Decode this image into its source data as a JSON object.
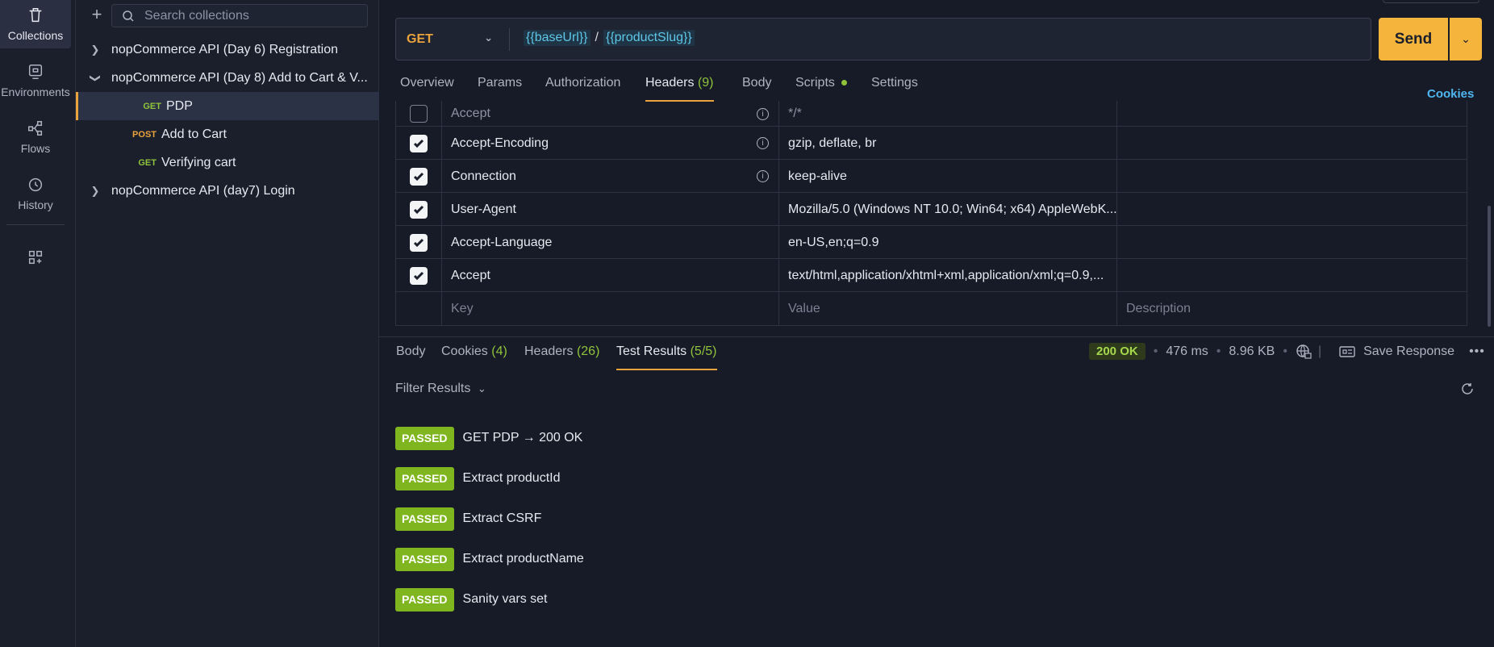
{
  "rail": {
    "items": [
      {
        "label": "Collections",
        "icon": "trash-can-icon"
      },
      {
        "label": "Environments",
        "icon": "environment-icon"
      },
      {
        "label": "Flows",
        "icon": "flows-icon"
      },
      {
        "label": "History",
        "icon": "history-icon"
      }
    ]
  },
  "sidebar": {
    "search_placeholder": "Search collections",
    "tree": [
      {
        "label": "nopCommerce API (Day 6) Registration",
        "chevron": "›"
      },
      {
        "label": "nopCommerce API (Day 8) Add to Cart & V...",
        "chevron": "⌄"
      },
      {
        "method": "GET",
        "label": "PDP"
      },
      {
        "method": "POST",
        "label": "Add to Cart"
      },
      {
        "method": "GET",
        "label": "Verifying cart"
      },
      {
        "label": "nopCommerce API (day7) Login",
        "chevron": "›"
      }
    ]
  },
  "request": {
    "method": "GET",
    "url_var1": "{{baseUrl}}",
    "url_sep": "/",
    "url_var2": "{{productSlug}}",
    "send_label": "Send"
  },
  "req_tabs": {
    "overview": "Overview",
    "params": "Params",
    "authorization": "Authorization",
    "headers": "Headers",
    "headers_count": "(9)",
    "body": "Body",
    "scripts": "Scripts",
    "settings": "Settings",
    "cookies": "Cookies"
  },
  "headers_table": {
    "rows": [
      {
        "key": "Accept",
        "value": "*/*"
      },
      {
        "key": "Accept-Encoding",
        "value": "gzip, deflate, br"
      },
      {
        "key": "Connection",
        "value": "keep-alive"
      },
      {
        "key": "User-Agent",
        "value": "Mozilla/5.0 (Windows NT 10.0; Win64; x64) AppleWebK..."
      },
      {
        "key": "Accept-Language",
        "value": "en-US,en;q=0.9"
      },
      {
        "key": "Accept",
        "value": "text/html,application/xhtml+xml,application/xml;q=0.9,..."
      }
    ],
    "placeholders": {
      "key": "Key",
      "value": "Value",
      "description": "Description"
    }
  },
  "response": {
    "tabs": {
      "body": "Body",
      "cookies": "Cookies",
      "cookies_count": "(4)",
      "headers": "Headers",
      "headers_count": "(26)",
      "tests": "Test Results",
      "tests_count": "(5/5)"
    },
    "status": "200 OK",
    "time": "476 ms",
    "size": "8.96 KB",
    "save_label": "Save Response",
    "filter_label": "Filter Results",
    "results": [
      {
        "badge": "PASSED",
        "name": "GET PDP → 200 OK"
      },
      {
        "badge": "PASSED",
        "name": "Extract productId"
      },
      {
        "badge": "PASSED",
        "name": "Extract CSRF"
      },
      {
        "badge": "PASSED",
        "name": "Extract productName"
      },
      {
        "badge": "PASSED",
        "name": "Sanity vars set"
      }
    ]
  },
  "colors": {
    "accent": "#f5b43c",
    "get": "#8fc33b",
    "post": "#e8a33c",
    "passed": "#7fb61f",
    "link": "#4fb6f0"
  }
}
